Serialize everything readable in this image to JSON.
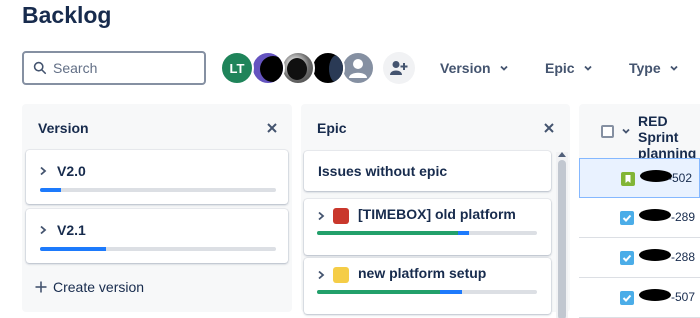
{
  "page": {
    "title": "Backlog"
  },
  "search": {
    "placeholder": "Search"
  },
  "avatars": {
    "first_initials": "LT"
  },
  "filters": {
    "version": "Version",
    "epic": "Epic",
    "type": "Type"
  },
  "version_panel": {
    "title": "Version",
    "versions": [
      {
        "name": "V2.0",
        "progress_done": 0,
        "progress_in_progress": 0.09
      },
      {
        "name": "V2.1",
        "progress_done": 0,
        "progress_in_progress": 0.28
      }
    ],
    "create_label": "Create version"
  },
  "epic_panel": {
    "title": "Epic",
    "no_epic_label": "Issues without epic",
    "epics": [
      {
        "name": "[TIMEBOX] old platform",
        "color": "#c9372c",
        "progress_done": 0.64,
        "progress_in_progress": 0.05
      },
      {
        "name": "new platform setup",
        "color": "#f5cd47",
        "progress_done": 0.56,
        "progress_in_progress": 0.1
      }
    ]
  },
  "sprint": {
    "title": "RED Sprint planning",
    "issues": [
      {
        "key_suffix": "-502",
        "type": "story"
      },
      {
        "key_suffix": "-289",
        "type": "task"
      },
      {
        "key_suffix": "-288",
        "type": "task"
      },
      {
        "key_suffix": "-507",
        "type": "task"
      }
    ]
  },
  "colors": {
    "done": "#22a06b",
    "in_progress": "#1d7afc",
    "track": "#dcdfe4",
    "story": "#82b536",
    "task": "#4bade8"
  },
  "icons": [
    "search-icon",
    "add-people-icon",
    "chevron-down-icon",
    "close-icon",
    "chevron-right-icon",
    "plus-icon"
  ]
}
